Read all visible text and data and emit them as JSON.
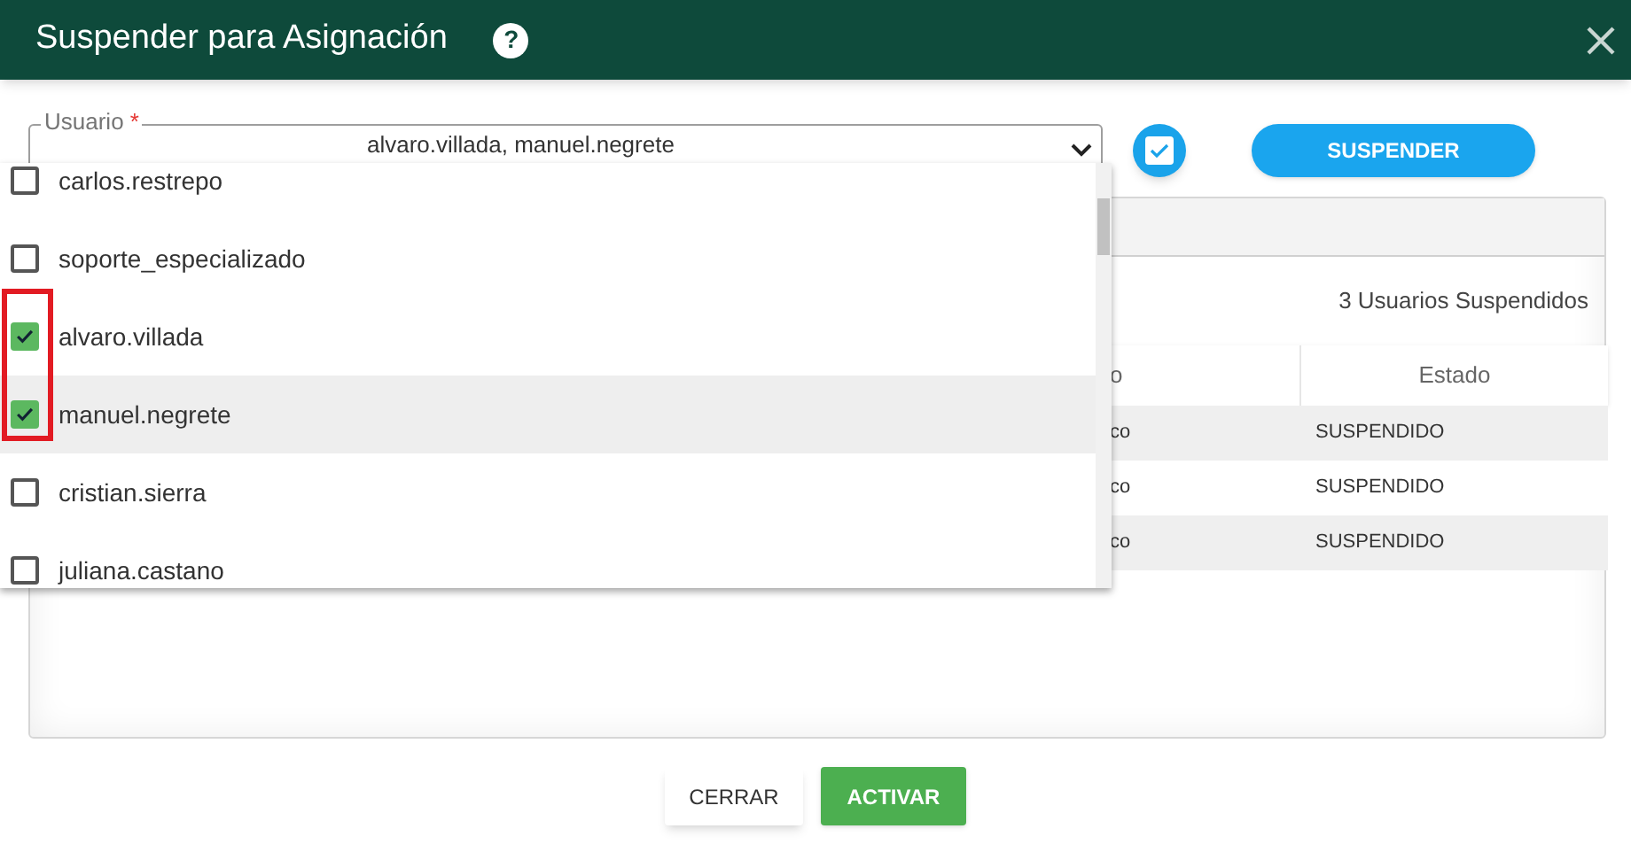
{
  "window": {
    "title": "Suspender para Asignación",
    "help": "?"
  },
  "field": {
    "label": "Usuario",
    "required_mark": "*",
    "value": "alvaro.villada, manuel.negrete"
  },
  "dropdown": {
    "items": [
      {
        "label": "carlos.restrepo",
        "checked": false,
        "highlighted": false
      },
      {
        "label": "soporte_especializado",
        "checked": false,
        "highlighted": false
      },
      {
        "label": "alvaro.villada",
        "checked": true,
        "highlighted": false
      },
      {
        "label": "manuel.negrete",
        "checked": true,
        "highlighted": true
      },
      {
        "label": "cristian.sierra",
        "checked": false,
        "highlighted": false
      },
      {
        "label": "juliana.castano",
        "checked": false,
        "highlighted": false
      }
    ]
  },
  "select_all": {
    "checked": true
  },
  "suspend_button": "SUSPENDER",
  "panel": {
    "count": "3 Usuarios Suspendidos",
    "table": {
      "columns": [
        "o",
        "Estado"
      ],
      "rows": [
        [
          "co",
          "SUSPENDIDO"
        ],
        [
          "co",
          "SUSPENDIDO"
        ],
        [
          "co",
          "SUSPENDIDO"
        ]
      ]
    }
  },
  "buttons": [
    {
      "label": "CERRAR",
      "kind": "plain"
    },
    {
      "label": "ACTIVAR",
      "kind": "primary"
    }
  ]
}
